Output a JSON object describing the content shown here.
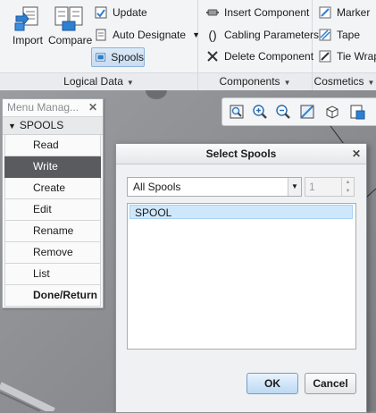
{
  "ribbon": {
    "import_label": "Import",
    "compare_label": "Compare",
    "update_label": "Update",
    "auto_designate_label": "Auto Designate",
    "spools_label": "Spools",
    "logical_data_label": "Logical Data",
    "insert_component_label": "Insert Component",
    "cabling_parameters_label": "Cabling Parameters",
    "delete_component_label": "Delete Component",
    "components_label": "Components",
    "marker_label": "Marker",
    "tape_label": "Tape",
    "tie_wrap_label": "Tie Wrap",
    "cosmetics_label": "Cosmetics"
  },
  "menu_manager": {
    "title": "Menu Manag...",
    "group": "SPOOLS",
    "items": [
      "Read",
      "Write",
      "Create",
      "Edit",
      "Rename",
      "Remove",
      "List",
      "Done/Return"
    ],
    "selected": "Write"
  },
  "dialog": {
    "title": "Select Spools",
    "filter_value": "All Spools",
    "spinner_value": "1",
    "list_items": [
      "SPOOL"
    ],
    "ok_label": "OK",
    "cancel_label": "Cancel"
  },
  "colors": {
    "accent": "#cfe7fb",
    "selected_menu": "#5a5b5e"
  }
}
